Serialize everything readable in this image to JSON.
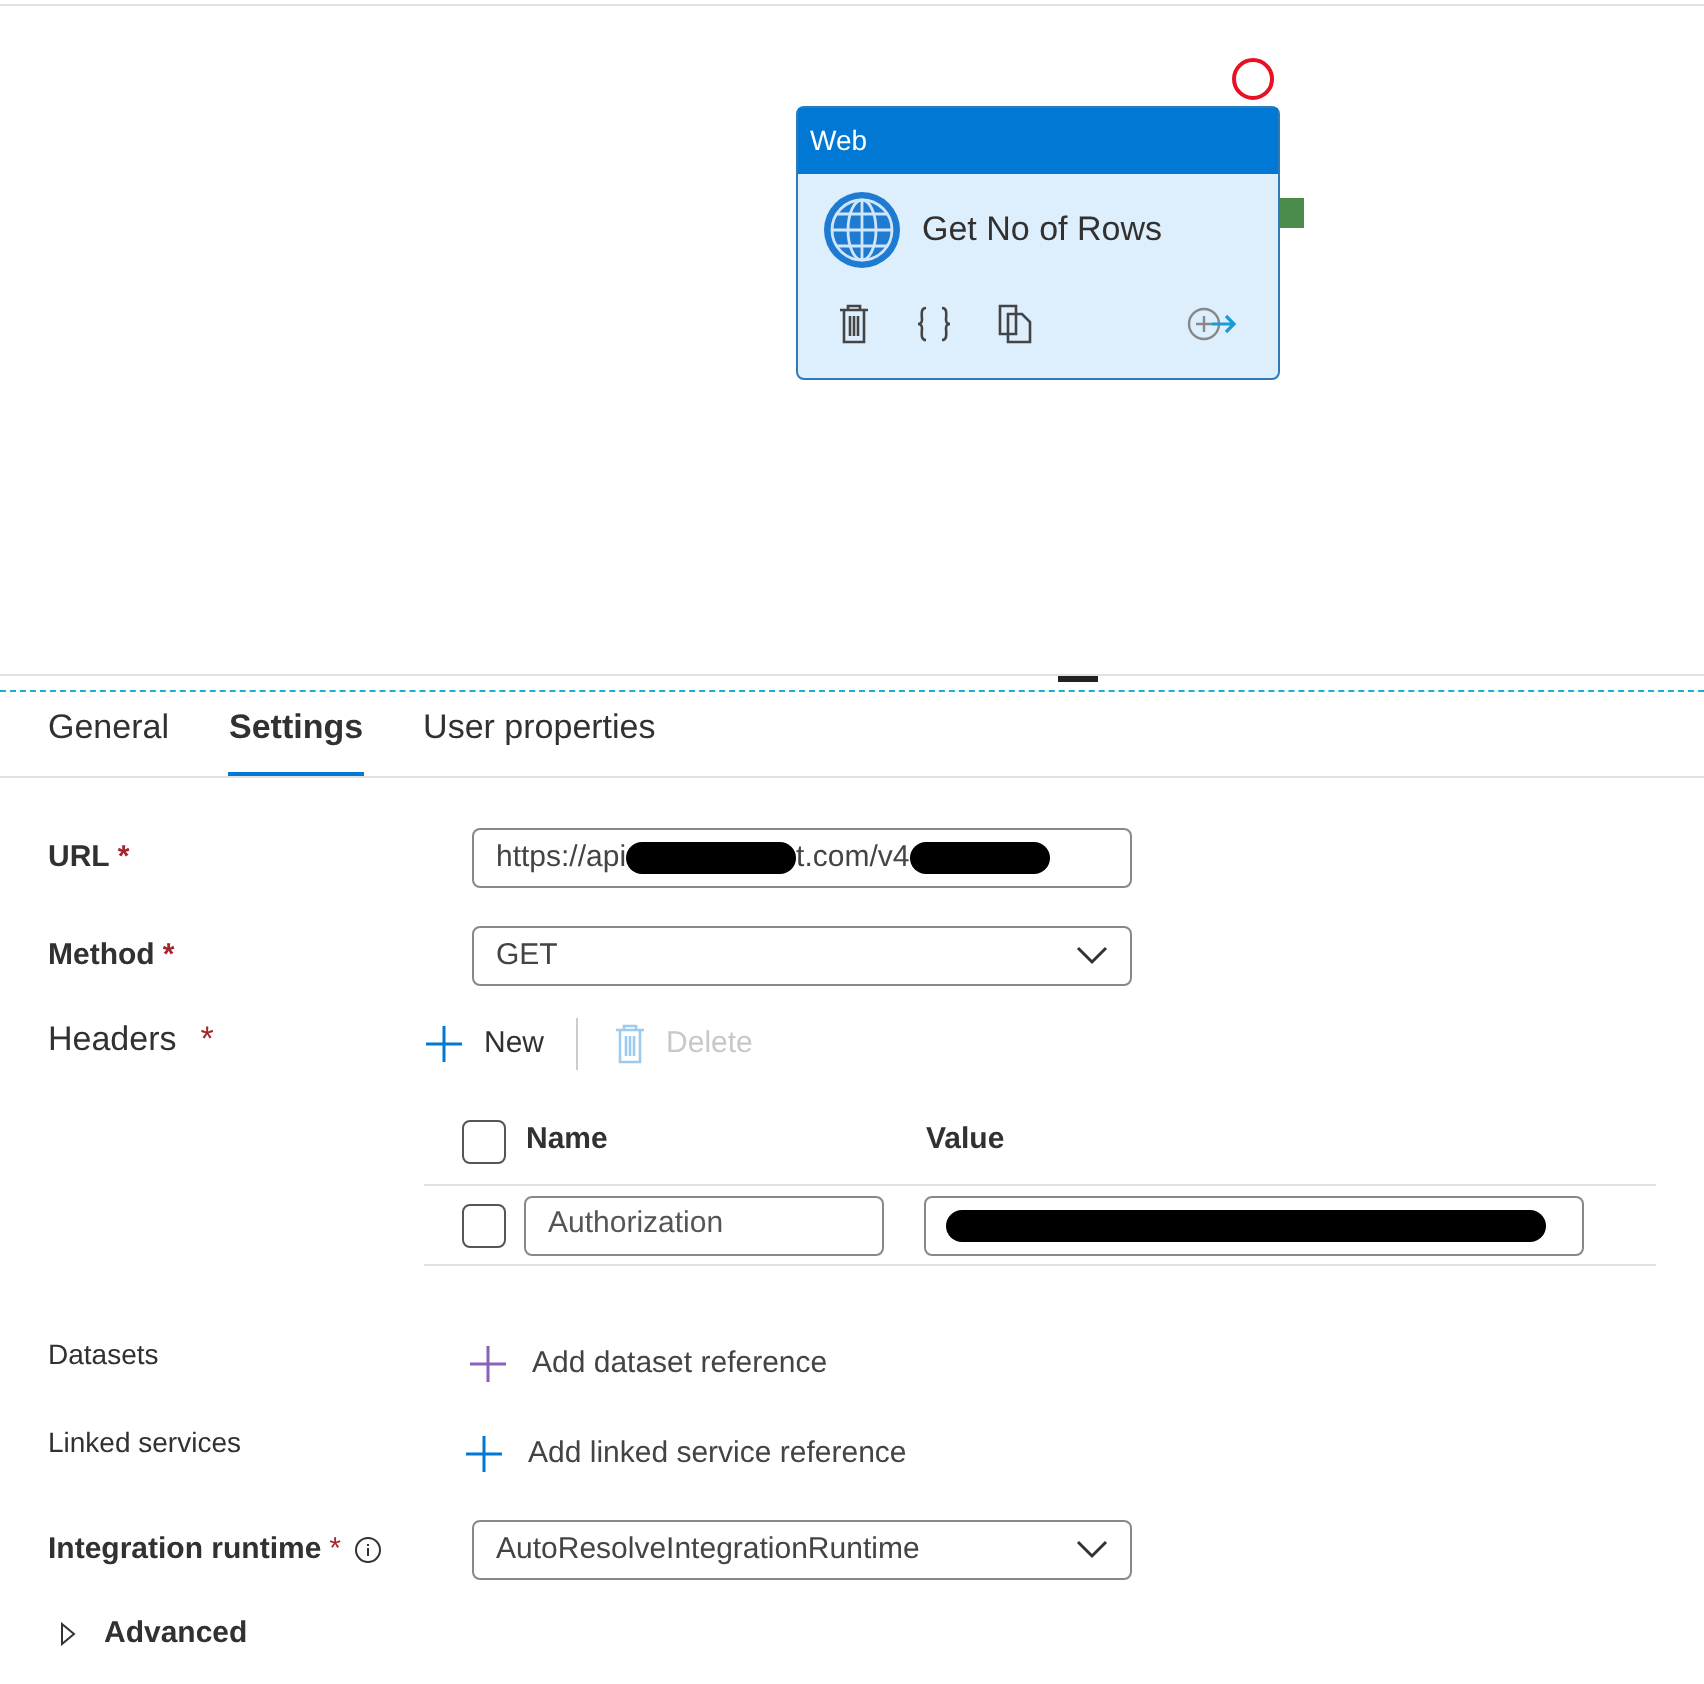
{
  "node": {
    "type_label": "Web",
    "name": "Get No of Rows"
  },
  "tabs": [
    {
      "label": "General",
      "selected": false
    },
    {
      "label": "Settings",
      "selected": true
    },
    {
      "label": "User properties",
      "selected": false
    }
  ],
  "url": {
    "label": "URL",
    "required_mark": "*",
    "value_parts": [
      "https://api",
      "t.com/v4"
    ]
  },
  "method": {
    "label": "Method",
    "required_mark": "*",
    "value": "GET"
  },
  "headers": {
    "label": "Headers",
    "required_mark": "*",
    "new_label": "New",
    "delete_label": "Delete",
    "delete_disabled": true,
    "columns": [
      "Name",
      "Value"
    ],
    "select_all_checked": false,
    "rows": [
      {
        "checked": false,
        "name": "Authorization"
      }
    ]
  },
  "datasets": {
    "label": "Datasets",
    "action": "Add dataset reference"
  },
  "linked_services": {
    "label": "Linked services",
    "action": "Add linked service reference"
  },
  "integration_runtime": {
    "label": "Integration runtime",
    "required_mark": "*",
    "value": "AutoResolveIntegrationRuntime"
  },
  "advanced": {
    "label": "Advanced",
    "expanded": false
  }
}
